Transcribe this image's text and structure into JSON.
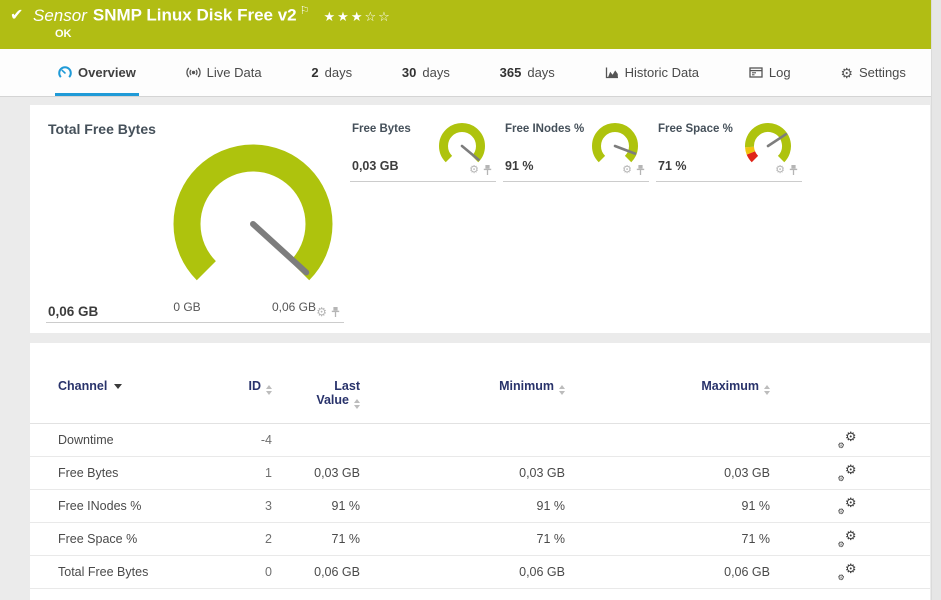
{
  "header": {
    "sensor_type_label": "Sensor",
    "sensor_name": "SNMP Linux Disk Free v2",
    "status": "OK",
    "check_glyph": "✔",
    "flag_glyph": "⚐",
    "stars": "★★★☆☆",
    "rating_filled": 3,
    "rating_total": 5
  },
  "colors": {
    "header_green": "#b1bd14",
    "gauge_green": "#aec30d",
    "warning_yellow": "#f1c40f",
    "error_red": "#e02418",
    "accent_blue": "#1f9ad7",
    "table_header_navy": "#29336b",
    "needle_gray": "#7d7d7d"
  },
  "tabs": [
    {
      "label": "Overview",
      "active": true
    },
    {
      "label": "Live Data"
    },
    {
      "prefix": "2",
      "label": "days"
    },
    {
      "prefix": "30",
      "label": "days"
    },
    {
      "prefix": "365",
      "label": "days"
    },
    {
      "label": "Historic Data"
    },
    {
      "label": "Log"
    },
    {
      "label": "Settings"
    }
  ],
  "gauges": {
    "main": {
      "title": "Total Free Bytes",
      "value": "0,06 GB",
      "scale_min": "0 GB",
      "scale_max": "0,06 GB",
      "needle_fraction": 0.99,
      "segments": [
        {
          "start": 0,
          "end": 1,
          "color": "#aec30d"
        }
      ]
    },
    "small": [
      {
        "title": "Free Bytes",
        "value": "0,03 GB",
        "needle_fraction": 0.98,
        "segments": [
          {
            "start": 0,
            "end": 1,
            "color": "#aec30d"
          }
        ]
      },
      {
        "title": "Free INodes %",
        "value": "91 %",
        "needle_fraction": 0.91,
        "segments": [
          {
            "start": 0,
            "end": 1,
            "color": "#aec30d"
          }
        ]
      },
      {
        "title": "Free Space %",
        "value": "71 %",
        "needle_fraction": 0.71,
        "segments": [
          {
            "start": 0,
            "end": 0.085,
            "color": "#e02418"
          },
          {
            "start": 0.085,
            "end": 0.155,
            "color": "#f1c40f"
          },
          {
            "start": 0.155,
            "end": 1,
            "color": "#aec30d"
          }
        ]
      }
    ]
  },
  "table": {
    "columns": {
      "channel": "Channel",
      "id": "ID",
      "last_value_line1": "Last",
      "last_value_line2": "Value",
      "minimum": "Minimum",
      "maximum": "Maximum"
    },
    "rows": [
      {
        "channel": "Downtime",
        "id": "-4",
        "last": "",
        "min": "",
        "max": ""
      },
      {
        "channel": "Free Bytes",
        "id": "1",
        "last": "0,03 GB",
        "min": "0,03 GB",
        "max": "0,03 GB"
      },
      {
        "channel": "Free INodes %",
        "id": "3",
        "last": "91 %",
        "min": "91 %",
        "max": "91 %"
      },
      {
        "channel": "Free Space %",
        "id": "2",
        "last": "71 %",
        "min": "71 %",
        "max": "71 %"
      },
      {
        "channel": "Total Free Bytes",
        "id": "0",
        "last": "0,06 GB",
        "min": "0,06 GB",
        "max": "0,06 GB"
      }
    ]
  }
}
